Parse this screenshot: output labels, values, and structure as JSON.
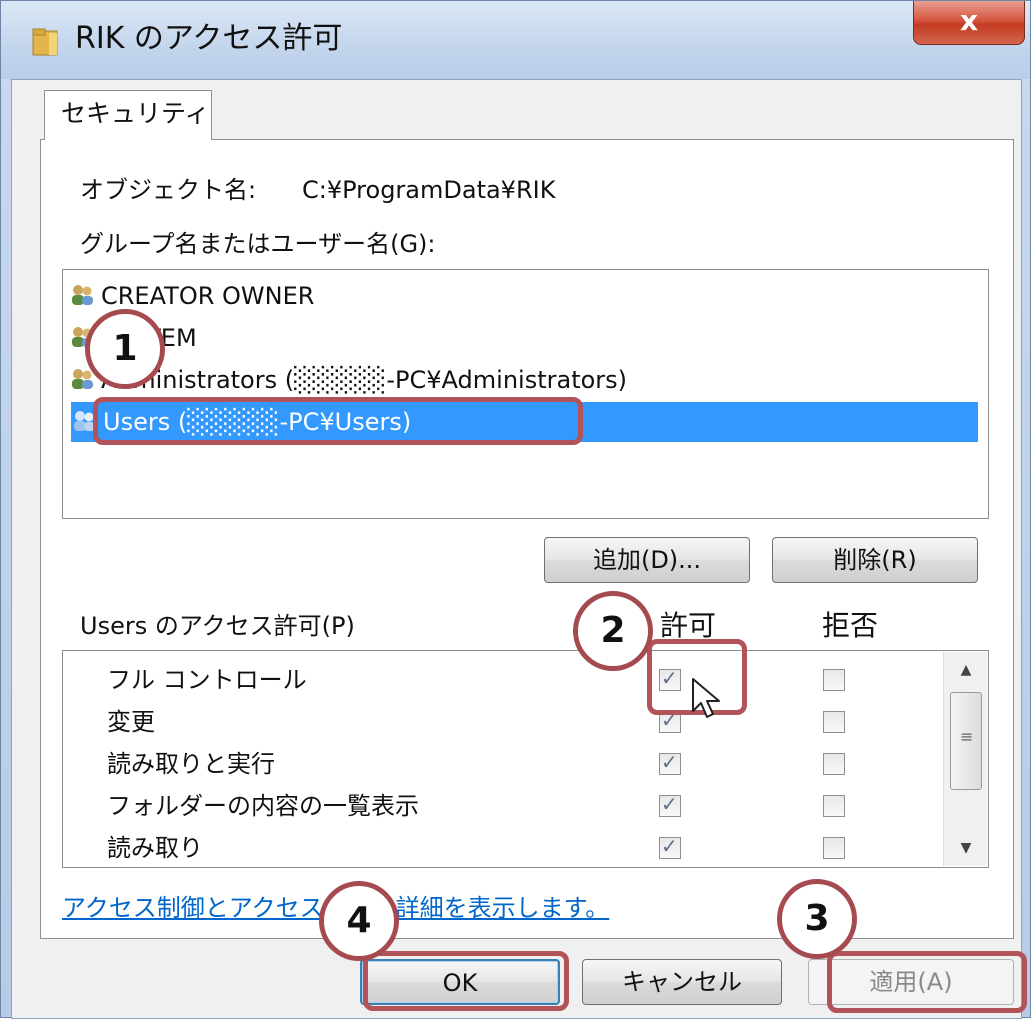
{
  "window": {
    "title": "RIK のアクセス許可",
    "close_label": "x"
  },
  "tabs": [
    {
      "label": "セキュリティ",
      "active": true
    }
  ],
  "object": {
    "label": "オブジェクト名:",
    "value": "C:¥ProgramData¥RIK"
  },
  "groups": {
    "label": "グループ名またはユーザー名(G):",
    "items": [
      {
        "name": "CREATOR OWNER",
        "icon": "users-group-icon",
        "selected": false
      },
      {
        "name": "SYSTEM",
        "icon": "users-group-icon",
        "selected": false
      },
      {
        "name": "Administrators (░░░░░-PC¥Administrators)",
        "icon": "users-group-icon",
        "selected": false
      },
      {
        "name": "Users (░░░░░-PC¥Users)",
        "icon": "users-group-icon",
        "selected": true
      }
    ]
  },
  "buttons": {
    "add": "追加(D)...",
    "remove": "削除(R)",
    "ok": "OK",
    "cancel": "キャンセル",
    "apply": "適用(A)"
  },
  "permissions": {
    "label": "Users のアクセス許可(P)",
    "allow_header": "許可",
    "deny_header": "拒否",
    "items": [
      {
        "name": "フル コントロール",
        "allow": true,
        "deny": false
      },
      {
        "name": "変更",
        "allow": true,
        "deny": false
      },
      {
        "name": "読み取りと実行",
        "allow": true,
        "deny": false
      },
      {
        "name": "フォルダーの内容の一覧表示",
        "allow": true,
        "deny": false
      },
      {
        "name": "読み取り",
        "allow": true,
        "deny": false
      }
    ]
  },
  "details_link": "アクセス制御とアクセス許可の詳細を表示します。",
  "annotations": {
    "step1": "1",
    "step2": "2",
    "step3": "3",
    "step4": "4",
    "highlight_color": "#b2535a"
  },
  "colors": {
    "selection": "#3399ff",
    "link": "#0066cc",
    "title_bar": "#c3d5ec",
    "close_button": "#c23b22"
  }
}
